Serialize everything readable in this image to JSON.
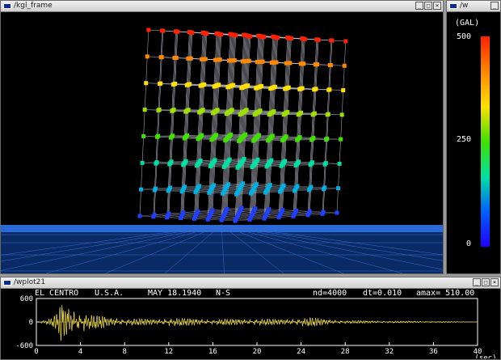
{
  "frame_window": {
    "title": "/kgl_frame",
    "buttons": [
      "_",
      "□",
      "×"
    ]
  },
  "scale_window": {
    "title": "/w",
    "unit": "(GAL)",
    "max_label": "500",
    "mid_label": "250",
    "min_label": "0",
    "gradient_colors": [
      "#ff2000",
      "#ff8800",
      "#ffe000",
      "#40e000",
      "#00e0a0",
      "#0060ff",
      "#2000ff"
    ]
  },
  "plot_window": {
    "title": "/wplot21",
    "header": {
      "event": "EL CENTRO",
      "country": "U.S.A.",
      "date": "MAY  18.1940",
      "component": "N-S",
      "nd": "nd=4000",
      "dt": "dt=0.010",
      "amax": "amax= 510.00"
    },
    "y_ticks": [
      "600",
      "0",
      "-600"
    ],
    "x_ticks": [
      "0",
      "4",
      "8",
      "12",
      "16",
      "20",
      "24",
      "28",
      "32",
      "36",
      "40"
    ],
    "x_unit": "(sec)"
  },
  "chart_data": {
    "type": "line",
    "xlabel": "(sec)",
    "ylabel": "",
    "xlim": [
      0,
      40
    ],
    "ylim": [
      -600,
      600
    ],
    "series": [
      {
        "name": "EL CENTRO N-S",
        "color": "#e8d44a",
        "x": [
          0,
          0.5,
          1.0,
          1.5,
          2.0,
          2.2,
          2.5,
          2.8,
          3.0,
          3.3,
          3.6,
          4.0,
          4.4,
          4.8,
          5.2,
          5.6,
          6.0,
          6.5,
          7.0,
          8.0,
          9.0,
          10.0,
          11.0,
          12.0,
          13.0,
          14.0,
          15.0,
          16.0,
          17.0,
          18.0,
          19.0,
          20.0,
          21.0,
          22.0,
          23.0,
          24.0,
          24.5,
          25.0,
          25.5,
          26.0,
          27.0,
          28.0,
          30.0,
          32.0,
          34.0,
          36.0,
          38.0,
          40.0
        ],
        "y": [
          0,
          40,
          -60,
          120,
          -250,
          500,
          -420,
          320,
          -380,
          260,
          -300,
          220,
          -260,
          180,
          -200,
          150,
          -160,
          90,
          -100,
          80,
          -90,
          70,
          -60,
          110,
          -100,
          80,
          -70,
          60,
          -80,
          70,
          -60,
          90,
          -80,
          60,
          -70,
          100,
          -120,
          110,
          -90,
          70,
          -50,
          40,
          -30,
          25,
          -20,
          15,
          -10,
          0
        ]
      }
    ]
  }
}
